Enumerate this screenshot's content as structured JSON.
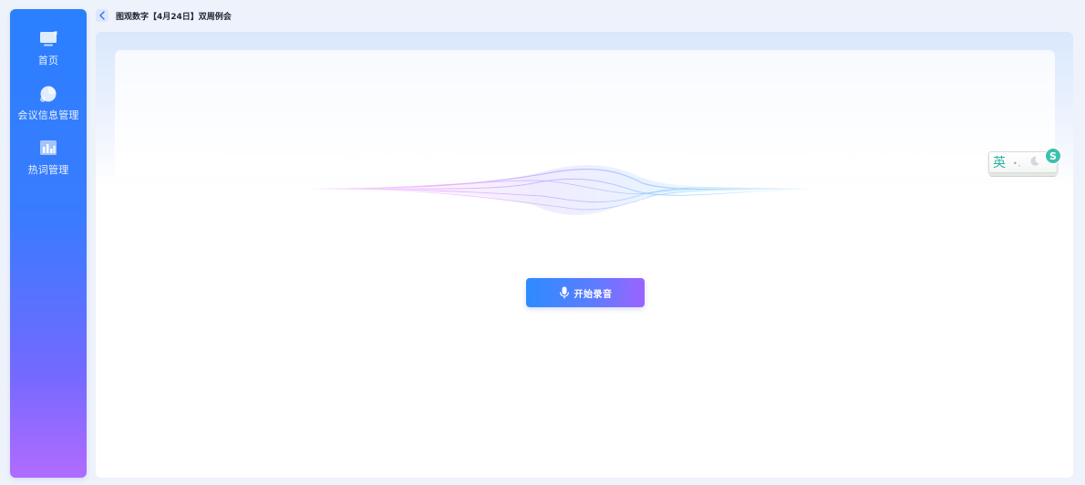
{
  "sidebar": {
    "items": [
      {
        "label": "首页",
        "icon": "monitor-icon"
      },
      {
        "label": "会议信息管理",
        "icon": "pie-chart-icon"
      },
      {
        "label": "热词管理",
        "icon": "bar-chart-icon"
      }
    ]
  },
  "header": {
    "back_icon": "chevron-left-icon",
    "title": "图观数字【4月24日】双周例会"
  },
  "main": {
    "record_button_label": "开始录音",
    "record_icon": "microphone-icon"
  },
  "ime": {
    "lang_label": "英",
    "dots_label": "•,",
    "logo_label": "S"
  },
  "colors": {
    "sidebar_top": "#2a80ff",
    "sidebar_bottom": "#b26bff",
    "button_start": "#2e8bff",
    "button_end": "#9c63ff",
    "ime_accent": "#3cc1ad"
  }
}
